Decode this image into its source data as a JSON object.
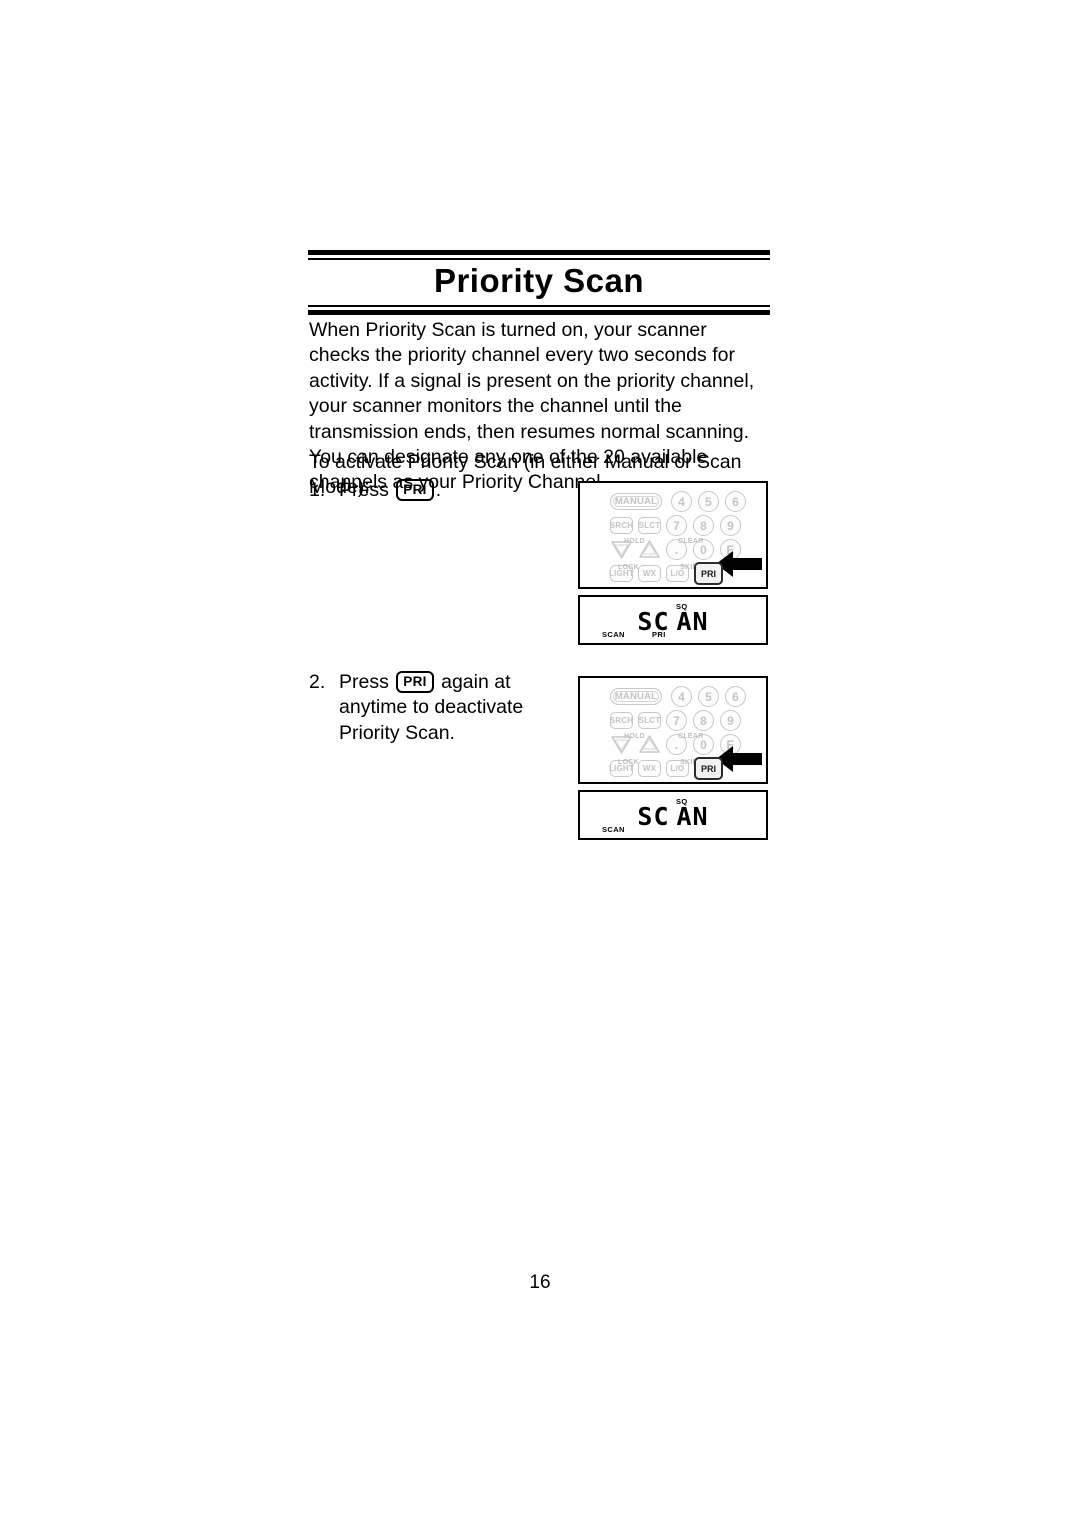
{
  "document": {
    "title": "Priority Scan",
    "page_number": "16",
    "paragraph": "When Priority Scan is turned on, your scanner checks the priority channel every two seconds for activity. If a signal is present on the priority channel, your scanner monitors the channel until the transmission ends, then resumes normal scanning. You can designate any one of the 20 available channels as your Priority Channel.",
    "intro_line": "To activate Priority Scan (in either Manual or Scan Mode):"
  },
  "steps": [
    {
      "number": "1.",
      "text_before_key": "Press",
      "key_label": "PRI",
      "text_after_key": "."
    },
    {
      "number": "2.",
      "text_before_key": "Press",
      "key_label": "PRI",
      "text_after_key": "again at anytime to deactivate Priority Scan."
    }
  ],
  "keypad": {
    "row1": [
      "MANUAL",
      "4",
      "5",
      "6"
    ],
    "row2": [
      "SRCH",
      "SLCT",
      "7",
      "8",
      "9"
    ],
    "row3_labels": [
      "HOLD",
      "CLEAR"
    ],
    "row3": [
      "down-triangle",
      "up-triangle",
      ".",
      "0",
      "E"
    ],
    "row4_labels": [
      "LOCK",
      "SKIP"
    ],
    "row4": [
      "LIGHT",
      "WX",
      "L/O",
      "PRI"
    ],
    "highlighted_key": "PRI",
    "pointer": "left-arrow"
  },
  "displays": [
    {
      "segment_text_left": "SC",
      "segment_text_right": "AN",
      "indicator_sq": "SQ",
      "indicator_scan": "SCAN",
      "indicator_pri": "PRI"
    },
    {
      "segment_text_left": "SC",
      "segment_text_right": "AN",
      "indicator_sq": "SQ",
      "indicator_scan": "SCAN",
      "indicator_pri": ""
    }
  ]
}
